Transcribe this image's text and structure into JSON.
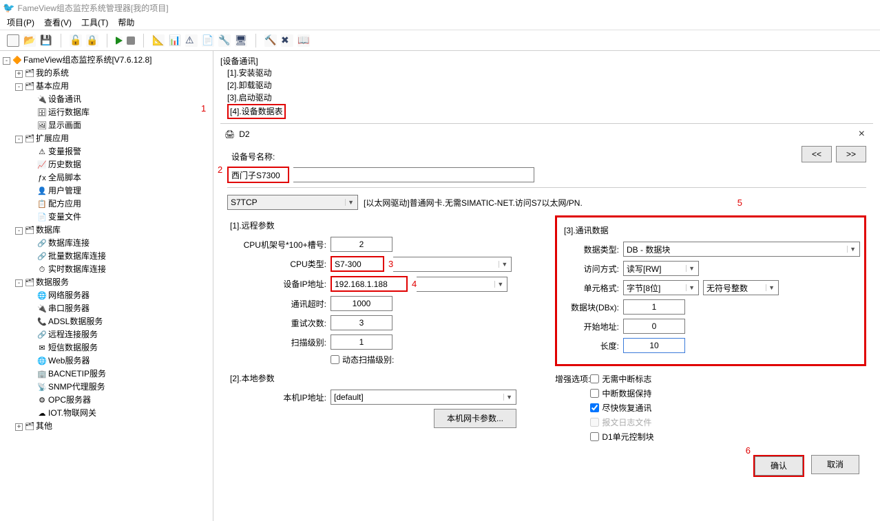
{
  "window_title": "FameView组态监控系统管理器[我的项目]",
  "menu": {
    "project": "项目(P)",
    "view": "查看(V)",
    "tools": "工具(T)",
    "help": "帮助"
  },
  "tree": {
    "root": "FameView组态监控系统[V7.6.12.8]",
    "my_system": "我的系统",
    "basic_app": "基本应用",
    "device_comm": "设备通讯",
    "run_db": "运行数据库",
    "display_screen": "显示画面",
    "ext_app": "扩展应用",
    "var_alarm": "变量报警",
    "history": "历史数据",
    "global_script": "全局脚本",
    "user_mgmt": "用户管理",
    "recipe": "配方应用",
    "var_file": "变量文件",
    "database": "数据库",
    "db_conn": "数据库连接",
    "batch_db": "批量数据库连接",
    "rt_db": "实时数据库连接",
    "data_service": "数据服务",
    "net_server": "网络服务器",
    "serial_server": "串口服务器",
    "adsl": "ADSL数据服务",
    "remote_conn": "远程连接服务",
    "sms": "短信数据服务",
    "web": "Web服务器",
    "bacnet": "BACNETIP服务",
    "snmp": "SNMP代理服务",
    "opc": "OPC服务器",
    "iot": "IOT.物联网关",
    "other": "其他"
  },
  "breadcrumb": {
    "title": "[设备通讯]",
    "items": [
      "[1].安装驱动",
      "[2].卸载驱动",
      "[3].启动驱动",
      "[4].设备数据表"
    ]
  },
  "dialog": {
    "title": "D2",
    "device_name_label": "设备号名称:",
    "device_name": "西门子S7300",
    "nav_prev": "<<",
    "nav_next": ">>",
    "protocol": "S7TCP",
    "protocol_desc": "[以太网驱动]普通网卡.无需SIMATIC-NET.访问S7以太网/PN.",
    "group1": "[1].远程参数",
    "cpu_rack_label": "CPU机架号*100+槽号:",
    "cpu_rack": "2",
    "cpu_type_label": "CPU类型:",
    "cpu_type": "S7-300",
    "ip_label": "设备IP地址:",
    "ip": "192.168.1.188",
    "timeout_label": "通讯超时:",
    "timeout": "1000",
    "retry_label": "重试次数:",
    "retry": "3",
    "scan_label": "扫描级别:",
    "scan_level": "1",
    "dyn_scan": "动态扫描级别:",
    "group2": "[2].本地参数",
    "local_ip_label": "本机IP地址:",
    "local_ip": "[default]",
    "nic_btn": "本机网卡参数...",
    "group3": "[3].通讯数据",
    "data_type_label": "数据类型:",
    "data_type": "DB - 数据块",
    "access_label": "访问方式:",
    "access": "读写[RW]",
    "unit_label": "单元格式:",
    "unit_fmt": "字节[8位]",
    "unit_sign": "无符号整数",
    "dbx_label": "数据块(DBx):",
    "dbx": "1",
    "start_label": "开始地址:",
    "start_addr": "0",
    "len_label": "长度:",
    "length": "10",
    "enh_label": "增强选项:",
    "opt1": "无需中断标志",
    "opt2": "中断数据保持",
    "opt3": "尽快恢复通讯",
    "opt4": "报文日志文件",
    "opt5": "D1单元控制块",
    "ok": "确认",
    "cancel": "取消"
  },
  "annotations": {
    "a1": "1",
    "a2": "2",
    "a3": "3",
    "a4": "4",
    "a5": "5",
    "a6": "6"
  },
  "chart_data": null
}
